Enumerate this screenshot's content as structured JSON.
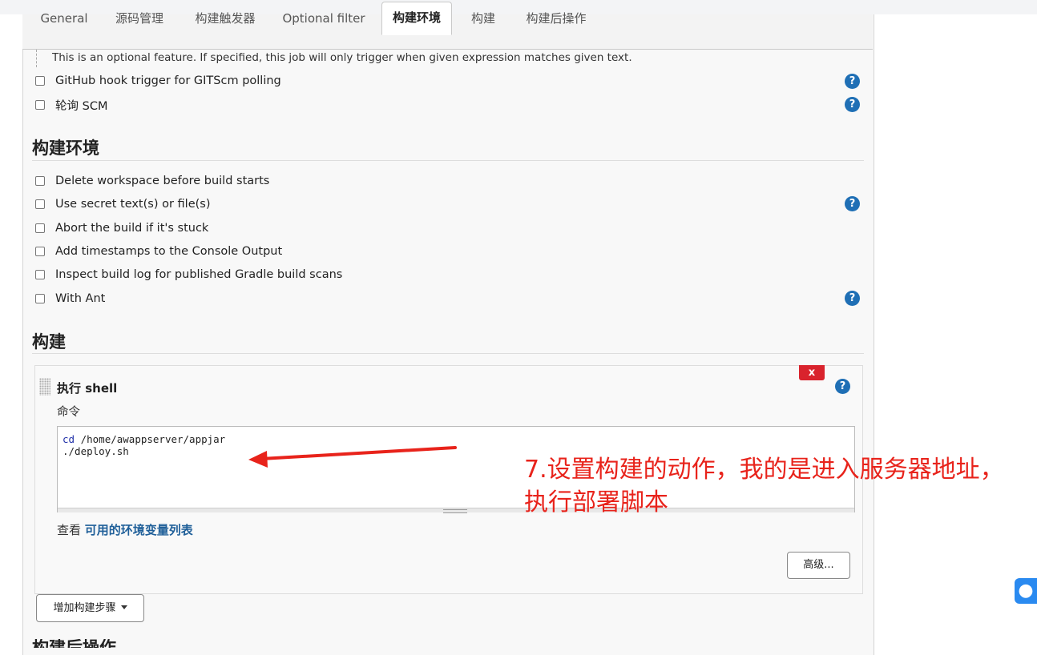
{
  "tabs": [
    {
      "label": "General"
    },
    {
      "label": "源码管理"
    },
    {
      "label": "构建触发器"
    },
    {
      "label": "Optional filter"
    },
    {
      "label": "构建环境"
    },
    {
      "label": "构建"
    },
    {
      "label": "构建后操作"
    }
  ],
  "optional_filter_hint": "This is an optional feature. If specified, this job will only trigger when given expression matches given text.",
  "triggers": [
    {
      "label": "GitHub hook trigger for GITScm polling"
    },
    {
      "label": "轮询 SCM"
    }
  ],
  "build_env": {
    "title": "构建环境",
    "options": [
      {
        "label": "Delete workspace before build starts"
      },
      {
        "label": "Use secret text(s) or file(s)"
      },
      {
        "label": "Abort the build if it's stuck"
      },
      {
        "label": "Add timestamps to the Console Output"
      },
      {
        "label": "Inspect build log for published Gradle build scans"
      },
      {
        "label": "With Ant"
      }
    ]
  },
  "build": {
    "title": "构建",
    "step_title": "执行 shell",
    "delete_label": "x",
    "command_label": "命令",
    "command_line1_kw": "cd",
    "command_line1_rest": " /home/awappserver/appjar",
    "command_line2": "./deploy.sh",
    "env_prefix": "查看 ",
    "env_link": "可用的环境变量列表",
    "advanced_button": "高级...",
    "add_step_button": "增加构建步骤"
  },
  "next_section_title": "构建后操作",
  "help_label": "?",
  "annotation": "7.设置构建的动作，我的是进入服务器地址，执行部署脚本",
  "colors": {
    "annotation": "#e8231b",
    "help": "#1f6fb5",
    "delete": "#d9232d",
    "link": "#1f5f99"
  }
}
